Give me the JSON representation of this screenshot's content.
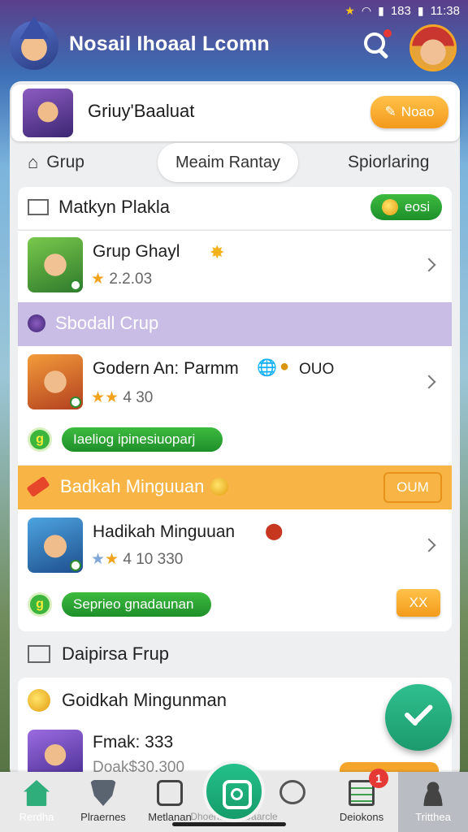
{
  "status_bar": {
    "time": "11:38",
    "signal_text": "183"
  },
  "header": {
    "title": "Nosail Ihoaal Lcomn"
  },
  "group_card": {
    "name": "Griuy'Baaluat",
    "button_label": "Noao"
  },
  "tabs": [
    {
      "label": "Grup"
    },
    {
      "label": "Meaim Rantay"
    },
    {
      "label": "Spiorlaring"
    }
  ],
  "sections": {
    "first": {
      "title": "Matkyn Plakla",
      "pill": "eosi"
    },
    "second": {
      "title": "Sbodall Crup"
    },
    "third": {
      "title": "Badkah Minguuan",
      "button": "OUM"
    },
    "fourth": {
      "title": "Daipirsa Frup"
    },
    "fifth": {
      "title": "Goidkah Mingunman"
    }
  },
  "rows": [
    {
      "title": "Grup Ghayl",
      "rating": "2.2.03"
    },
    {
      "title": "Godern An: Parmm",
      "extra": "OUO",
      "rating": "4 30",
      "pill": "Iaeliog ipinesiuoparj"
    },
    {
      "title": "Hadikah Minguuan",
      "rating": "4 10 330",
      "pill": "Seprieo gnadaunan",
      "action": "XX"
    },
    {
      "title": "Fmak: 333",
      "rating": "Doak$30.300"
    }
  ],
  "nav": [
    {
      "label": "Rerdha"
    },
    {
      "label": "Plraernes"
    },
    {
      "label": "Metlanan"
    },
    {
      "label": "Dhoenail St Gaarcle"
    },
    {
      "label": "Deiokons"
    },
    {
      "label": "Tritthea"
    }
  ],
  "badges": {
    "notifications": "1"
  },
  "colors": {
    "accent_green": "#1e8f2a",
    "accent_orange": "#f39a1b",
    "section_purple": "#c9bde6",
    "section_orange": "#f8b545"
  }
}
